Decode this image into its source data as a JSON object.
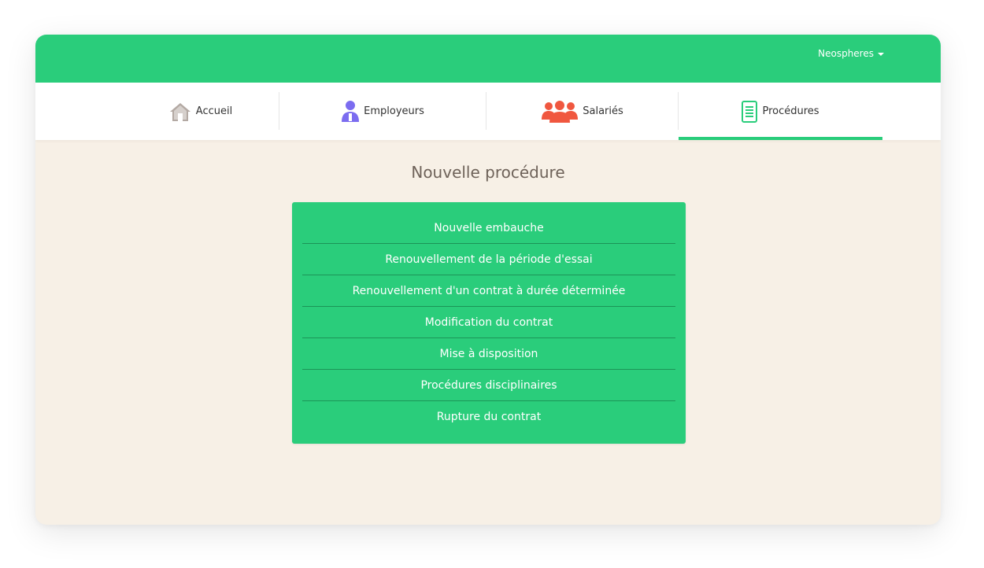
{
  "header": {
    "user_menu_label": "Neospheres",
    "brand_color": "#2acd7b"
  },
  "nav": {
    "tabs": [
      {
        "label": "Accueil",
        "icon": "house-icon",
        "active": false
      },
      {
        "label": "Employeurs",
        "icon": "person-icon",
        "active": false
      },
      {
        "label": "Salariés",
        "icon": "group-icon",
        "active": false
      },
      {
        "label": "Procédures",
        "icon": "document-icon",
        "active": true
      }
    ]
  },
  "main": {
    "title": "Nouvelle procédure",
    "procedures": [
      "Nouvelle embauche",
      "Renouvellement de la période d'essai",
      "Renouvellement d'un contrat à durée déterminée",
      "Modification du contrat",
      "Mise à disposition",
      "Procédures disciplinaires",
      "Rupture du contrat"
    ]
  }
}
